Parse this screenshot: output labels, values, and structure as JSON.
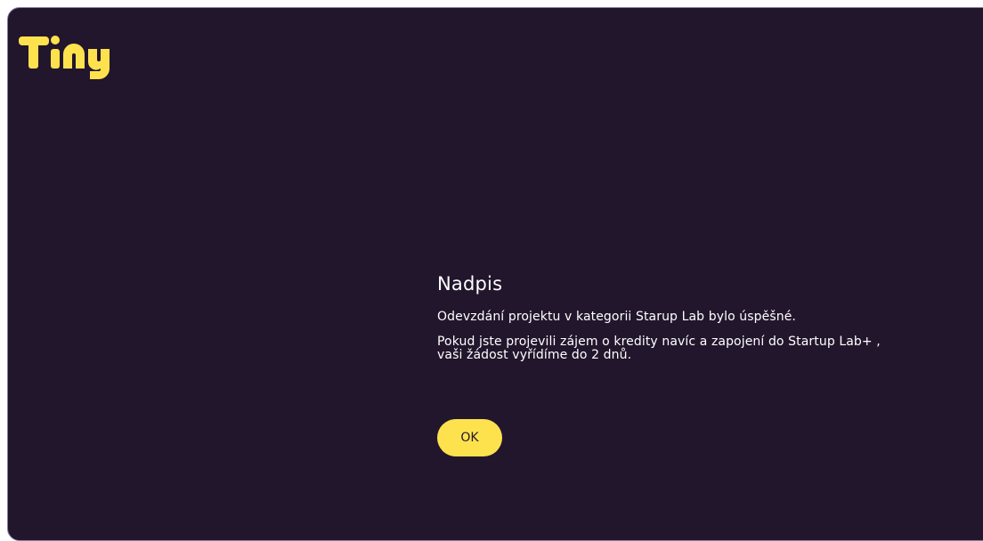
{
  "logo": {
    "text": "Tiny",
    "color": "#fde24e"
  },
  "dialog": {
    "title": "Nadpis",
    "message": "Odevzdání projektu v kategorii Starup Lab bylo úspěšné.",
    "info_line1": "Pokud jste projevili zájem o kredity navíc a zapojení do Startup Lab+ ,",
    "info_line2": "vaši žádost vyřídíme do 2 dnů.",
    "ok_label": "OK"
  },
  "colors": {
    "background": "#22162d",
    "accent": "#fde24e",
    "text": "#ffffff"
  }
}
